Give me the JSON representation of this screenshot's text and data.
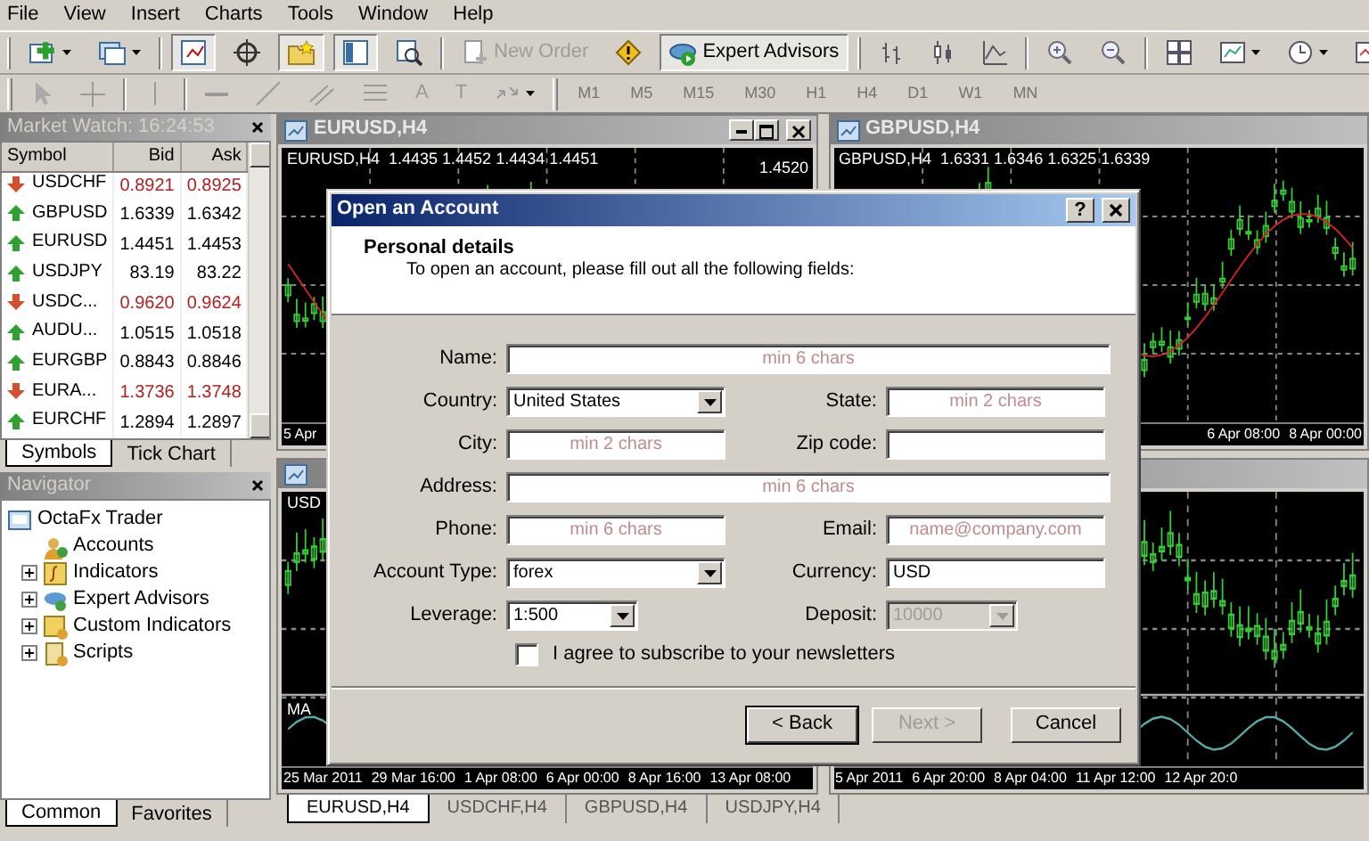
{
  "menu": [
    "File",
    "View",
    "Insert",
    "Charts",
    "Tools",
    "Window",
    "Help"
  ],
  "toolbar": {
    "new_order": {
      "label": "New Order",
      "disabled": true
    },
    "expert_advisors": {
      "label": "Expert Advisors",
      "pressed": true
    }
  },
  "drawing_toolbar": {
    "text_tools": [
      "A",
      "T"
    ],
    "timeframes": [
      {
        "label": "M1",
        "disabled": true
      },
      {
        "label": "M5",
        "disabled": true
      },
      {
        "label": "M15",
        "disabled": true
      },
      {
        "label": "M30",
        "disabled": true
      },
      {
        "label": "H1",
        "disabled": true
      },
      {
        "label": "H4",
        "disabled": true
      },
      {
        "label": "D1",
        "disabled": true
      },
      {
        "label": "W1",
        "disabled": true
      },
      {
        "label": "MN",
        "disabled": true
      }
    ]
  },
  "market_watch": {
    "title": "Market Watch: 16:24:53",
    "columns": [
      "Symbol",
      "Bid",
      "Ask"
    ],
    "rows": [
      {
        "symbol": "USDCHF",
        "bid": "0.8921",
        "ask": "0.8925",
        "kind": "down"
      },
      {
        "symbol": "GBPUSD",
        "bid": "1.6339",
        "ask": "1.6342",
        "kind": "up"
      },
      {
        "symbol": "EURUSD",
        "bid": "1.4451",
        "ask": "1.4453",
        "kind": "up"
      },
      {
        "symbol": "USDJPY",
        "bid": "83.19",
        "ask": "83.22",
        "kind": "up"
      },
      {
        "symbol": "USDC...",
        "bid": "0.9620",
        "ask": "0.9624",
        "kind": "down"
      },
      {
        "symbol": "AUDU...",
        "bid": "1.0515",
        "ask": "1.0518",
        "kind": "up"
      },
      {
        "symbol": "EURGBP",
        "bid": "0.8843",
        "ask": "0.8846",
        "kind": "up"
      },
      {
        "symbol": "EURA...",
        "bid": "1.3736",
        "ask": "1.3748",
        "kind": "down"
      },
      {
        "symbol": "EURCHF",
        "bid": "1.2894",
        "ask": "1.2897",
        "kind": "up"
      }
    ],
    "tabs": [
      {
        "label": "Symbols",
        "selected": true
      },
      {
        "label": "Tick Chart",
        "selected": false
      }
    ]
  },
  "navigator": {
    "title": "Navigator",
    "tree": [
      {
        "label": "OctaFx Trader",
        "kind": "terminal",
        "children": [
          {
            "label": "Accounts",
            "kind": "accounts",
            "expandable": false
          },
          {
            "label": "Indicators",
            "kind": "indicators",
            "expandable": true
          },
          {
            "label": "Expert Advisors",
            "kind": "experts",
            "expandable": true
          },
          {
            "label": "Custom Indicators",
            "kind": "custom",
            "expandable": true
          },
          {
            "label": "Scripts",
            "kind": "scripts",
            "expandable": true
          }
        ]
      }
    ],
    "tabs": [
      {
        "label": "Common",
        "selected": true
      },
      {
        "label": "Favorites",
        "selected": false
      }
    ]
  },
  "charts": [
    {
      "title": "EURUSD,H4",
      "header": "EURUSD,H4  1.4435 1.4452 1.4434 1.4451",
      "price": "1.4520",
      "time_labels": [
        "5 Apr"
      ],
      "window_buttons": true,
      "indicator": false,
      "ma": true
    },
    {
      "title": "GBPUSD,H4",
      "header": "GBPUSD,H4  1.6331 1.6346 1.6325 1.6339",
      "time_labels": [
        "6 Apr 08:00",
        "8 Apr 00:00"
      ],
      "window_buttons": false,
      "indicator": false,
      "ma": true
    },
    {
      "header": "USD",
      "sub_label": "MA",
      "time_labels": [
        "25 Mar 2011",
        "29 Mar 16:00",
        "1 Apr 08:00",
        "6 Apr 00:00",
        "8 Apr 16:00",
        "13 Apr 08:00"
      ],
      "window_buttons": false,
      "indicator": true,
      "ma": false
    },
    {
      "time_labels": [
        "5 Apr 2011",
        "6 Apr 20:00",
        "8 Apr 04:00",
        "11 Apr 12:00",
        "12 Apr 20:0"
      ],
      "window_buttons": false,
      "indicator": true,
      "ma": false
    }
  ],
  "chart_tabs": [
    {
      "label": "EURUSD,H4",
      "selected": true
    },
    {
      "label": "USDCHF,H4",
      "selected": false
    },
    {
      "label": "GBPUSD,H4",
      "selected": false
    },
    {
      "label": "USDJPY,H4",
      "selected": false
    }
  ],
  "dialog": {
    "title": "Open an Account",
    "help": "?",
    "header": "Personal details",
    "subtitle": "To open an account, please fill out all the following fields:",
    "rows": [
      [
        {
          "label": "Name:",
          "kind": "text",
          "placeholder": "min 6 chars"
        }
      ],
      [
        {
          "label": "Country:",
          "kind": "select",
          "value": "United States"
        },
        {
          "label": "State:",
          "kind": "text",
          "placeholder": "min 2 chars"
        }
      ],
      [
        {
          "label": "City:",
          "kind": "text",
          "placeholder": "min 2 chars"
        },
        {
          "label": "Zip code:",
          "kind": "text"
        }
      ],
      [
        {
          "label": "Address:",
          "kind": "text",
          "placeholder": "min 6 chars"
        }
      ],
      [
        {
          "label": "Phone:",
          "kind": "text",
          "placeholder": "min 6 chars"
        },
        {
          "label": "Email:",
          "kind": "text",
          "placeholder": "name@company.com"
        }
      ],
      [
        {
          "label": "Account Type:",
          "kind": "select",
          "value": "forex"
        },
        {
          "label": "Currency:",
          "kind": "text",
          "value": "USD"
        }
      ],
      [
        {
          "label": "Leverage:",
          "kind": "short_select",
          "value": "1:500"
        },
        {
          "label": "Deposit:",
          "kind": "short_select",
          "value": "10000",
          "disabled": true
        }
      ]
    ],
    "newsletter": {
      "label": "I agree to subscribe to your newsletters",
      "checked": false
    },
    "buttons": [
      {
        "label": "< Back",
        "disabled": false,
        "default": true
      },
      {
        "label": "Next >",
        "disabled": true,
        "default": false
      },
      {
        "label": "Cancel",
        "disabled": false,
        "default": false
      }
    ]
  }
}
